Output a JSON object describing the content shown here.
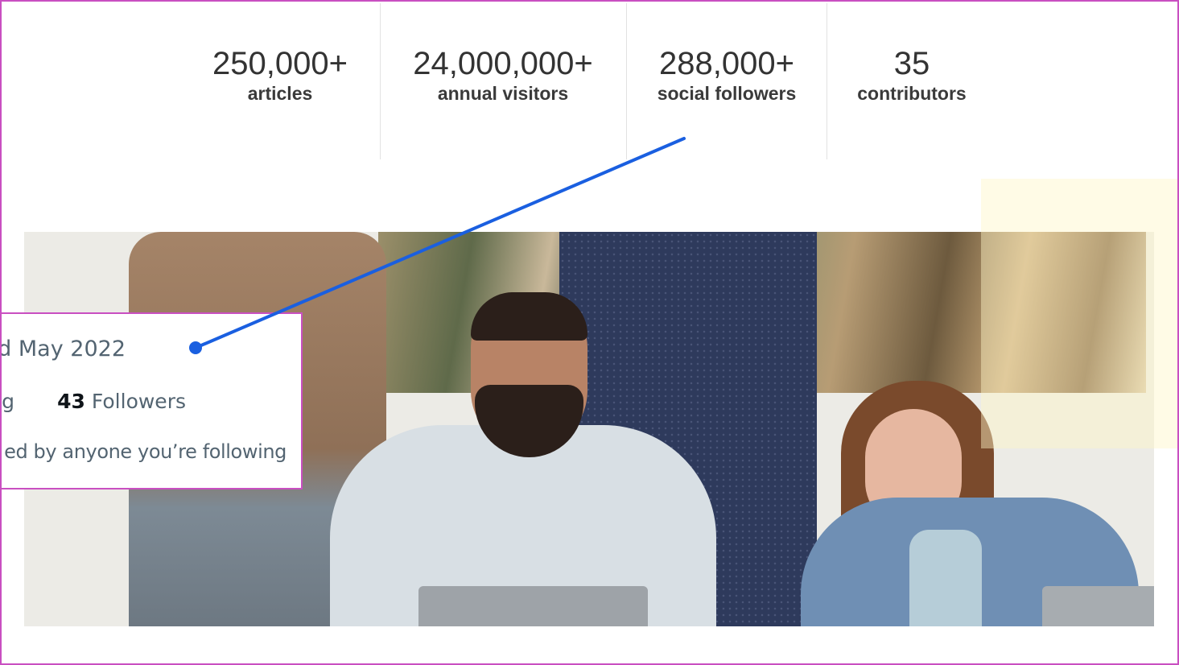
{
  "stats": [
    {
      "value": "250,000+",
      "label": "articles"
    },
    {
      "value": "24,000,000+",
      "label": "annual visitors"
    },
    {
      "value": "288,000+",
      "label": "social followers"
    },
    {
      "value": "35",
      "label": "contributors"
    }
  ],
  "profile_card": {
    "joined": "d May 2022",
    "following_fragment": "ng",
    "followers_count": "43",
    "followers_label": "Followers",
    "not_followed_text": "ed by anyone you’re following"
  },
  "colors": {
    "annotation_border": "#c94fc1",
    "connector_line": "#1a5fe0",
    "stat_text": "#333333",
    "card_muted_text": "#536471"
  },
  "icons": {
    "connector_dot": "pointer-dot-icon"
  }
}
